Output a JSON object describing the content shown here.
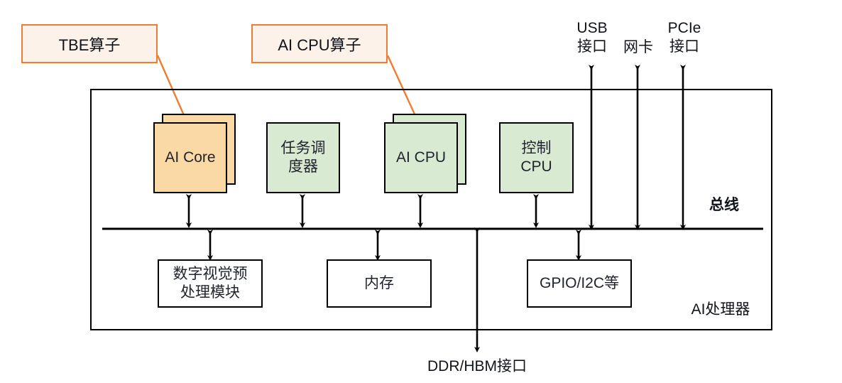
{
  "diagram": {
    "title_label": "AI处理器",
    "bus_label": "总线",
    "colors": {
      "accent_orange": "#ED7D31",
      "core_fill": "#FBD9A5",
      "cpu_fill": "#D9EAD3",
      "callout_fill": "#FDF2EA",
      "outline": "#000000"
    }
  },
  "callouts": [
    {
      "id": "tbe",
      "label": "TBE算子"
    },
    {
      "id": "aicpu",
      "label": "AI CPU算子"
    }
  ],
  "compute_blocks": [
    {
      "id": "ai-core",
      "label": "AI Core",
      "stacked": true,
      "fill": "orange"
    },
    {
      "id": "task-scheduler",
      "label": "任务调\n度器",
      "stacked": false,
      "fill": "green"
    },
    {
      "id": "ai-cpu",
      "label": "AI CPU",
      "stacked": true,
      "fill": "green"
    },
    {
      "id": "control-cpu",
      "label": "控制\nCPU",
      "stacked": false,
      "fill": "green"
    }
  ],
  "peripheral_blocks": [
    {
      "id": "dvpp",
      "label": "数字视觉预\n处理模块"
    },
    {
      "id": "memory",
      "label": "内存"
    },
    {
      "id": "gpio",
      "label": "GPIO/I2C等"
    }
  ],
  "external_interfaces": [
    {
      "id": "usb",
      "label": "USB\n接口"
    },
    {
      "id": "nic",
      "label": "网卡"
    },
    {
      "id": "pcie",
      "label": "PCIe\n接口"
    }
  ],
  "bottom_interface": {
    "id": "ddr-hbm",
    "label": "DDR/HBM接口"
  }
}
